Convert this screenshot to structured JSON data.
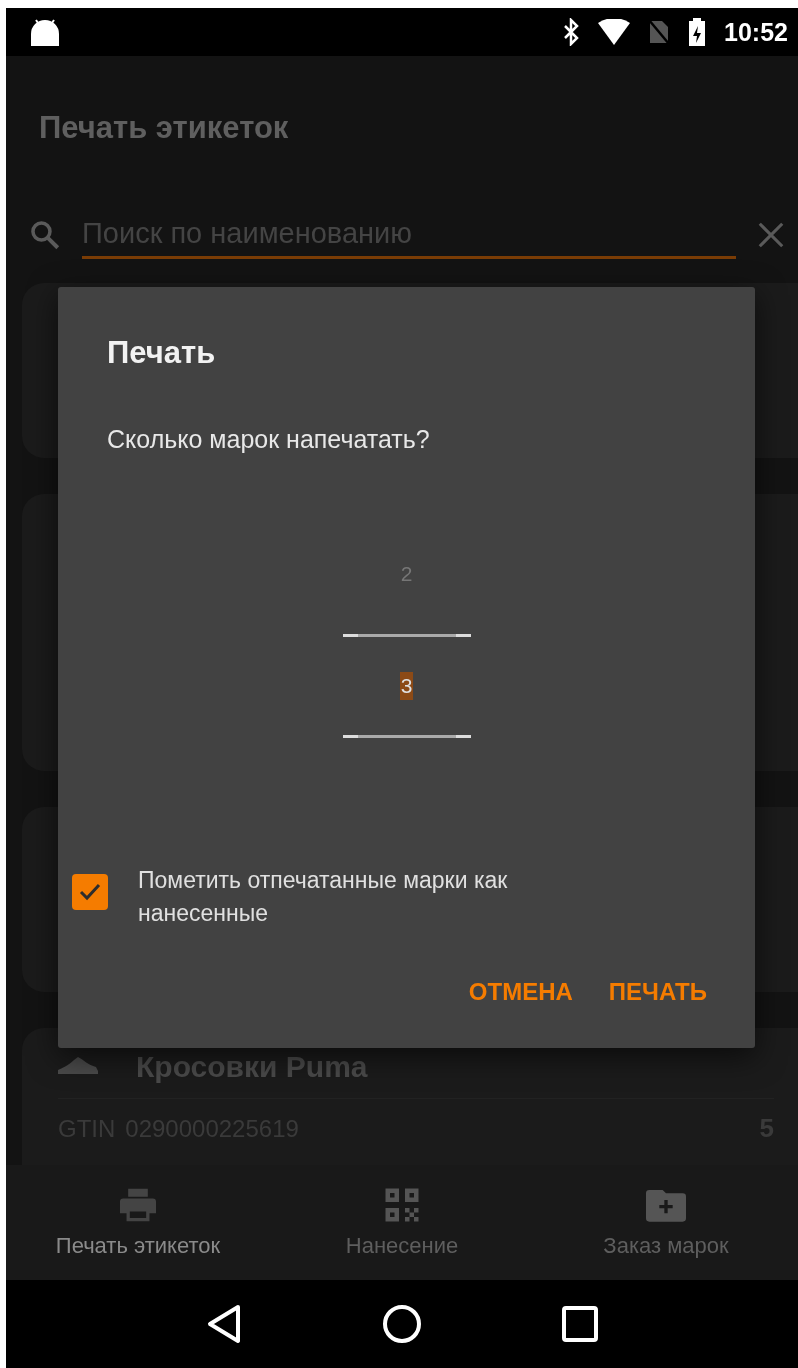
{
  "status_bar": {
    "time": "10:52"
  },
  "app_bar": {
    "title": "Печать этикеток"
  },
  "search": {
    "placeholder": "Поиск по наименованию"
  },
  "list": {
    "card": {
      "title": "Кросовки Puma",
      "gtin_label": "GTIN",
      "gtin": "0290000225619",
      "count": "5"
    }
  },
  "dialog": {
    "title": "Печать",
    "message": "Сколько марок напечатать?",
    "picker": [
      {
        "text": "2",
        "selected": false
      },
      {
        "text": "3",
        "selected": true
      }
    ],
    "checkbox": {
      "label": "Пометить отпечатанные марки как нанесенные",
      "checked": true
    },
    "buttons": [
      "ОТМЕНА",
      "ПЕЧАТЬ"
    ]
  },
  "bottom_nav": [
    {
      "label": "Печать этикеток",
      "selected": true
    },
    {
      "label": "Нанесение",
      "selected": false
    },
    {
      "label": "Заказ марок",
      "selected": false
    }
  ]
}
